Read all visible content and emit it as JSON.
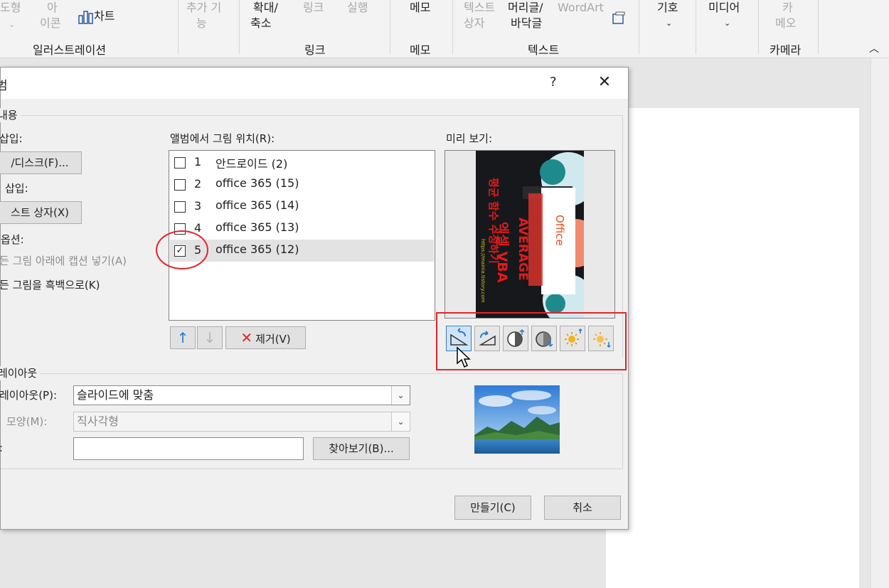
{
  "ribbon": {
    "items": [
      {
        "text": "도형",
        "disabled": true
      },
      {
        "text": "아",
        "disabled": true
      },
      {
        "text": "이콘",
        "disabled": true
      },
      {
        "text": "차트",
        "disabled": false
      },
      {
        "text": "추가 기",
        "disabled": true
      },
      {
        "text": "능",
        "disabled": true
      },
      {
        "text": "확대/",
        "disabled": false
      },
      {
        "text": "축소",
        "disabled": false
      },
      {
        "text": "링크",
        "disabled": true
      },
      {
        "text": "실행",
        "disabled": true
      },
      {
        "text": "메모",
        "disabled": false
      },
      {
        "text": "텍스트",
        "disabled": true
      },
      {
        "text": "상자",
        "disabled": true
      },
      {
        "text": "머리글/",
        "disabled": false
      },
      {
        "text": "바닥글",
        "disabled": false
      },
      {
        "text": "WordArt",
        "disabled": true
      },
      {
        "text": "기호",
        "disabled": false
      },
      {
        "text": "미디어",
        "disabled": false
      },
      {
        "text": "카",
        "disabled": true
      },
      {
        "text": "메오",
        "disabled": true
      }
    ],
    "groups": [
      "일러스트레이션",
      "링크",
      "메모",
      "텍스트",
      "카메라"
    ]
  },
  "dialog": {
    "title": "범",
    "help": "?",
    "close": "✕",
    "content_section": "내용",
    "insert_from": "삽입:",
    "file_disk_button": "/디스크(F)...",
    "text_insert": "삽입:",
    "textbox_button": "스트 상자(X)",
    "caption_options": "옵션:",
    "caption_below": "든 그림 아래에 캡션 넣기(A)",
    "bw_all": "든 그림을 흑백으로(K)",
    "list_label": "앨범에서 그림 위치(R):",
    "pictures": [
      {
        "num": "1",
        "name": "안드로이드 (2)",
        "checked": false,
        "selected": false
      },
      {
        "num": "2",
        "name": "office 365 (15)",
        "checked": false,
        "selected": false
      },
      {
        "num": "3",
        "name": "office 365 (14)",
        "checked": false,
        "selected": false
      },
      {
        "num": "4",
        "name": "office 365 (13)",
        "checked": false,
        "selected": false
      },
      {
        "num": "5",
        "name": "office 365 (12)",
        "checked": true,
        "selected": true
      }
    ],
    "remove_button": "제거(V)",
    "preview_label": "미리 보기:",
    "preview_image": {
      "title_line1": "엑셀 VBA",
      "title_line2": "AVERAGE",
      "subtitle": "평균 함수 수정하기",
      "url": "https://mainia.tistory.com",
      "office_badge": "Office"
    },
    "tools": [
      "rotate-left-icon",
      "rotate-right-icon",
      "contrast-increase-icon",
      "contrast-decrease-icon",
      "brightness-increase-icon",
      "brightness-decrease-icon"
    ],
    "layout_section": "레이아웃",
    "layout_label": "레이아웃(P):",
    "layout_value": "슬라이드에 맞춤",
    "frame_label": "모양(M):",
    "frame_value": "직사각형",
    "theme_label": ":",
    "theme_value": "",
    "browse_button": "찾아보기(B)...",
    "create_button": "만들기(C)",
    "cancel_button": "취소"
  },
  "colors": {
    "accent_red": "#e0262a",
    "selection": "#e3e3e3",
    "dialog_bg": "#f0f0f0"
  }
}
